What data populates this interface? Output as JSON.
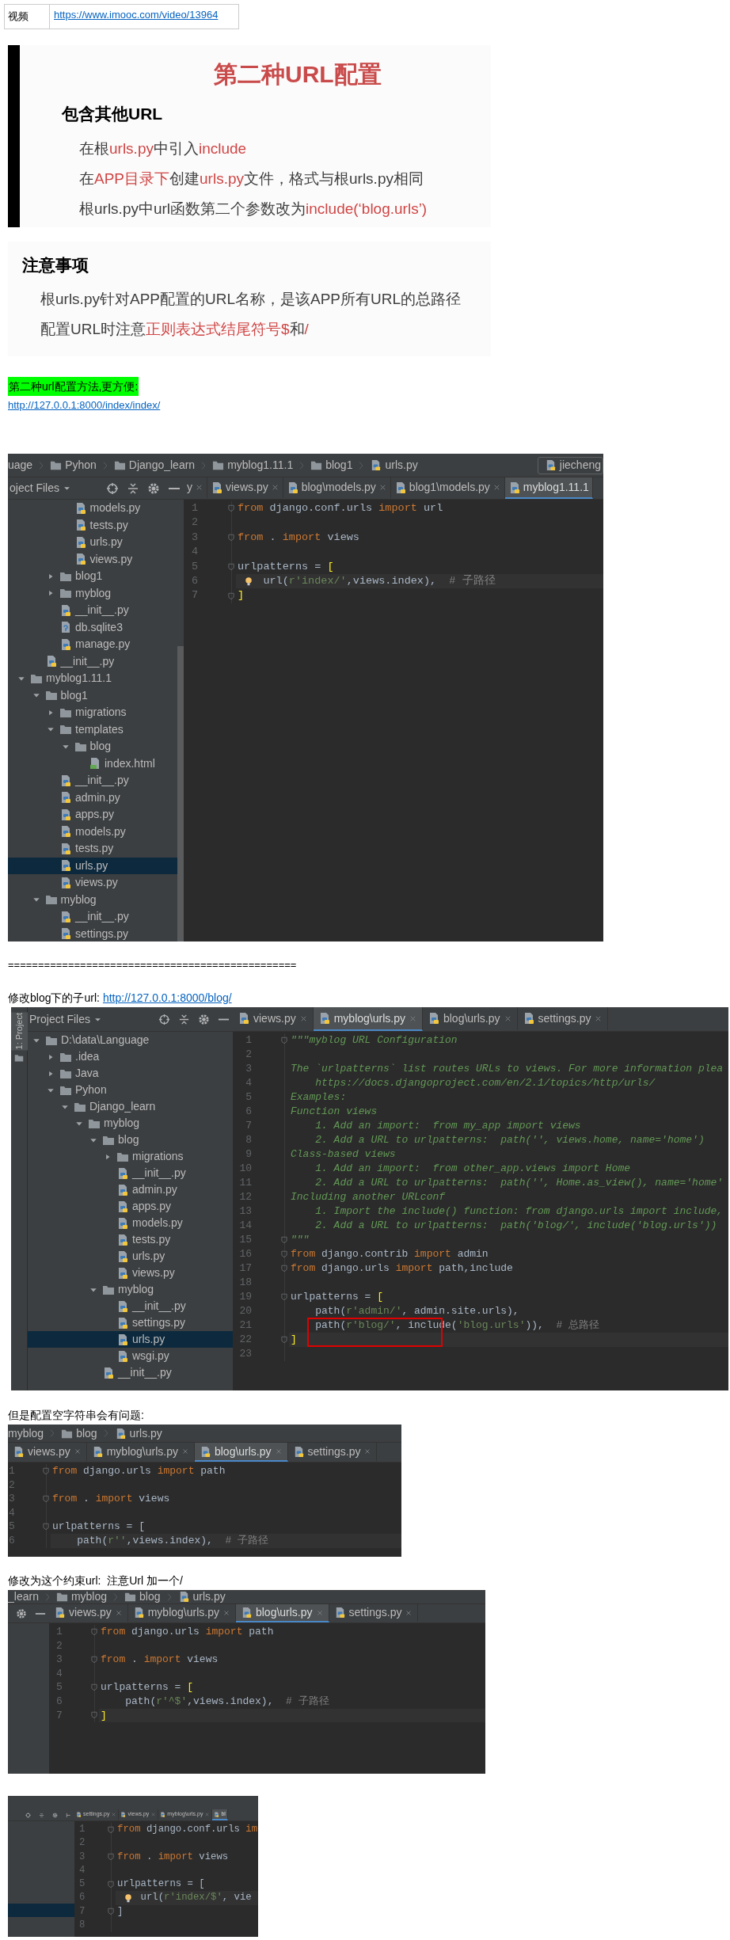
{
  "content": [
    {
      "kind": "table",
      "rows": [
        {
          "label": "视频",
          "link": "https://www.imooc.com/video/13964"
        }
      ]
    },
    {
      "kind": "slide",
      "accent_bar": true,
      "title": "第二种URL配置",
      "heading": "包含其他URL",
      "lines": [
        {
          "segments": [
            {
              "text": "在根",
              "red": false
            },
            {
              "text": "urls.py",
              "red": true
            },
            {
              "text": "中引入",
              "red": false
            },
            {
              "text": "include",
              "red": true
            }
          ]
        },
        {
          "segments": [
            {
              "text": "在",
              "red": false
            },
            {
              "text": "APP目录下",
              "red": true
            },
            {
              "text": "创建",
              "red": false
            },
            {
              "text": "urls.py",
              "red": true
            },
            {
              "text": "文件，格式与根urls.py相同",
              "red": false
            }
          ]
        },
        {
          "segments": [
            {
              "text": "根urls.py中url函数第二个参数改为",
              "red": false
            },
            {
              "text": "include(‘blog.urls’)",
              "red": true
            }
          ]
        }
      ]
    },
    {
      "kind": "slide",
      "accent_bar": false,
      "heading": "注意事项",
      "lines": [
        {
          "segments": [
            {
              "text": "根urls.py针对APP配置的URL名称，是该APP所有URL的总路径",
              "red": false
            }
          ]
        },
        {
          "segments": [
            {
              "text": "配置URL时注意",
              "red": false
            },
            {
              "text": "正则表达式结尾符号$",
              "red": true
            },
            {
              "text": "和",
              "red": false
            },
            {
              "text": "/",
              "red": true
            }
          ]
        }
      ]
    },
    {
      "kind": "note",
      "text": "第二种url配置方法,更方便:",
      "highlighted": true
    },
    {
      "kind": "link",
      "url": "http://127.0.0.1:8000/index/index/"
    },
    {
      "kind": "ide",
      "breadcrumbs": [
        {
          "label": "uage",
          "kind": "partial"
        },
        {
          "label": "Pyhon",
          "kind": "folder"
        },
        {
          "label": "Django_learn",
          "kind": "folder"
        },
        {
          "label": "myblog1.11.1",
          "kind": "folder"
        },
        {
          "label": "blog1",
          "kind": "folder"
        },
        {
          "label": "urls.py",
          "kind": "file"
        }
      ],
      "run_config": "jiecheng",
      "sidebar": {
        "title": "oject Files",
        "tree": [
          {
            "children": [
              {
                "children": [
                  {
                    "children": [
                      {
                        "label": "models.py",
                        "kind": "py",
                        "selected": false
                      },
                      {
                        "label": "tests.py",
                        "kind": "py",
                        "selected": false
                      },
                      {
                        "label": "urls.py",
                        "kind": "py",
                        "selected": false
                      },
                      {
                        "label": "views.py",
                        "kind": "py",
                        "selected": false
                      }
                    ]
                  },
                  {
                    "label": "blog1",
                    "kind": "folder",
                    "expanded": false,
                    "selected": false
                  },
                  {
                    "label": "myblog",
                    "kind": "folder",
                    "expanded": false,
                    "selected": false
                  },
                  {
                    "label": "__init__.py",
                    "kind": "py",
                    "selected": false
                  },
                  {
                    "label": "db.sqlite3",
                    "kind": "db",
                    "selected": false
                  },
                  {
                    "label": "manage.py",
                    "kind": "py",
                    "selected": false
                  }
                ]
              },
              {
                "label": "__init__.py",
                "kind": "py",
                "selected": false
              }
            ]
          },
          {
            "label": "myblog1.11.1",
            "kind": "folder",
            "expanded": true,
            "selected": false,
            "children": [
              {
                "label": "blog1",
                "kind": "folder",
                "expanded": true,
                "selected": false,
                "children": [
                  {
                    "label": "migrations",
                    "kind": "folder",
                    "expanded": false,
                    "selected": false
                  },
                  {
                    "label": "templates",
                    "kind": "folder",
                    "expanded": true,
                    "selected": false,
                    "children": [
                      {
                        "label": "blog",
                        "kind": "folder",
                        "expanded": true,
                        "selected": false,
                        "children": [
                          {
                            "label": "index.html",
                            "kind": "html",
                            "selected": false
                          }
                        ]
                      }
                    ]
                  },
                  {
                    "label": "__init__.py",
                    "kind": "py",
                    "selected": false
                  },
                  {
                    "label": "admin.py",
                    "kind": "py",
                    "selected": false
                  },
                  {
                    "label": "apps.py",
                    "kind": "py",
                    "selected": false
                  },
                  {
                    "label": "models.py",
                    "kind": "py",
                    "selected": false
                  },
                  {
                    "label": "tests.py",
                    "kind": "py",
                    "selected": false
                  },
                  {
                    "label": "urls.py",
                    "kind": "py",
                    "selected": true
                  },
                  {
                    "label": "views.py",
                    "kind": "py",
                    "selected": false
                  }
                ]
              },
              {
                "label": "myblog",
                "kind": "folder",
                "expanded": true,
                "selected": false,
                "children": [
                  {
                    "label": "__init__.py",
                    "kind": "py",
                    "selected": false
                  },
                  {
                    "label": "settings.py",
                    "kind": "py",
                    "selected": false
                  }
                ]
              }
            ]
          }
        ]
      },
      "tabs": [
        {
          "label": "y",
          "icon": false,
          "closable": true,
          "selected": false
        },
        {
          "label": "views.py",
          "icon": true,
          "closable": true,
          "selected": false
        },
        {
          "label": "blog\\models.py",
          "icon": true,
          "closable": true,
          "selected": false
        },
        {
          "label": "blog1\\models.py",
          "icon": true,
          "closable": true,
          "selected": false
        },
        {
          "label": "myblog1.11.1",
          "icon": true,
          "closable": false,
          "selected": true
        }
      ],
      "lines": [
        {
          "number": "1",
          "fold": true,
          "tokens": [
            {
              "kind": "keyword",
              "text": "from"
            },
            {
              "kind": "plain",
              "text": " django.conf.urls "
            },
            {
              "kind": "keyword",
              "text": "import"
            },
            {
              "kind": "plain",
              "text": " url"
            }
          ]
        },
        {
          "number": "2"
        },
        {
          "number": "3",
          "fold": true,
          "tokens": [
            {
              "kind": "keyword",
              "text": "from"
            },
            {
              "kind": "plain",
              "text": " . "
            },
            {
              "kind": "keyword",
              "text": "import"
            },
            {
              "kind": "plain",
              "text": " views"
            }
          ]
        },
        {
          "number": "4"
        },
        {
          "number": "5",
          "fold": true,
          "tokens": [
            {
              "kind": "plain",
              "text": "urlpatterns = "
            },
            {
              "kind": "bracket",
              "text": "["
            }
          ]
        },
        {
          "number": "6",
          "current": true,
          "bulb": true,
          "tokens": [
            {
              "kind": "plain",
              "text": "    url("
            },
            {
              "kind": "string",
              "text": "r'index/'"
            },
            {
              "kind": "plain",
              "text": ",views.index),  "
            },
            {
              "kind": "comment",
              "text": "# 子路径"
            }
          ]
        },
        {
          "number": "7",
          "fold": true,
          "tokens": [
            {
              "kind": "bracket",
              "text": "]"
            }
          ]
        }
      ]
    },
    {
      "kind": "rule",
      "text": "================================================"
    },
    {
      "kind": "paragraph",
      "text": "修改blog下的子url:",
      "link": "http://127.0.0.1:8000/blog/"
    },
    {
      "kind": "ide",
      "tool_strip": {
        "label": "1: Project"
      },
      "sidebar": {
        "title": "Project Files",
        "tree": [
          {
            "label": "D:\\data\\Language",
            "kind": "folder",
            "expanded": true,
            "selected": false,
            "children": [
              {
                "label": ".idea",
                "kind": "folder",
                "expanded": false,
                "selected": false
              },
              {
                "label": "Java",
                "kind": "folder",
                "expanded": false,
                "selected": false
              },
              {
                "label": "Pyhon",
                "kind": "folder",
                "expanded": true,
                "selected": false,
                "children": [
                  {
                    "label": "Django_learn",
                    "kind": "folder",
                    "expanded": true,
                    "selected": false,
                    "children": [
                      {
                        "label": "myblog",
                        "kind": "folder",
                        "expanded": true,
                        "selected": false,
                        "children": [
                          {
                            "label": "blog",
                            "kind": "folder",
                            "expanded": true,
                            "selected": false,
                            "children": [
                              {
                                "label": "migrations",
                                "kind": "folder",
                                "expanded": false,
                                "selected": false
                              },
                              {
                                "label": "__init__.py",
                                "kind": "py",
                                "selected": false
                              },
                              {
                                "label": "admin.py",
                                "kind": "py",
                                "selected": false
                              },
                              {
                                "label": "apps.py",
                                "kind": "py",
                                "selected": false
                              },
                              {
                                "label": "models.py",
                                "kind": "py",
                                "selected": false
                              },
                              {
                                "label": "tests.py",
                                "kind": "py",
                                "selected": false
                              },
                              {
                                "label": "urls.py",
                                "kind": "py",
                                "selected": false
                              },
                              {
                                "label": "views.py",
                                "kind": "py",
                                "selected": false
                              }
                            ]
                          },
                          {
                            "label": "myblog",
                            "kind": "folder",
                            "expanded": true,
                            "selected": false,
                            "children": [
                              {
                                "label": "__init__.py",
                                "kind": "py",
                                "selected": false
                              },
                              {
                                "label": "settings.py",
                                "kind": "py",
                                "selected": false
                              },
                              {
                                "label": "urls.py",
                                "kind": "py",
                                "selected": true
                              },
                              {
                                "label": "wsgi.py",
                                "kind": "py",
                                "selected": false
                              }
                            ]
                          },
                          {
                            "label": "__init__.py",
                            "kind": "py",
                            "selected": false
                          }
                        ]
                      }
                    ]
                  }
                ]
              }
            ]
          }
        ]
      },
      "tabs": [
        {
          "label": "views.py",
          "icon": true,
          "closable": true,
          "selected": false
        },
        {
          "label": "myblog\\urls.py",
          "icon": true,
          "closable": true,
          "selected": true
        },
        {
          "label": "blog\\urls.py",
          "icon": true,
          "closable": true,
          "selected": false
        },
        {
          "label": "settings.py",
          "icon": true,
          "closable": true,
          "selected": false
        }
      ],
      "lines": [
        {
          "number": "1",
          "fold": true,
          "tokens": [
            {
              "kind": "docstring",
              "text": "\"\"\"myblog URL Configuration"
            }
          ]
        },
        {
          "number": "2"
        },
        {
          "number": "3",
          "tokens": [
            {
              "kind": "docstring",
              "text": "The `urlpatterns` list routes URLs to views. For more information plea"
            }
          ]
        },
        {
          "number": "4",
          "tokens": [
            {
              "kind": "docstring",
              "text": "    https://docs.djangoproject.com/en/2.1/topics/http/urls/"
            }
          ]
        },
        {
          "number": "5",
          "tokens": [
            {
              "kind": "docstring",
              "text": "Examples:"
            }
          ]
        },
        {
          "number": "6",
          "tokens": [
            {
              "kind": "docstring",
              "text": "Function views"
            }
          ]
        },
        {
          "number": "7",
          "tokens": [
            {
              "kind": "docstring",
              "text": "    1. Add an import:  from my_app import views"
            }
          ]
        },
        {
          "number": "8",
          "tokens": [
            {
              "kind": "docstring",
              "text": "    2. Add a URL to urlpatterns:  path('', views.home, name='home')"
            }
          ]
        },
        {
          "number": "9",
          "tokens": [
            {
              "kind": "docstring",
              "text": "Class-based views"
            }
          ]
        },
        {
          "number": "10",
          "tokens": [
            {
              "kind": "docstring",
              "text": "    1. Add an import:  from other_app.views import Home"
            }
          ]
        },
        {
          "number": "11",
          "tokens": [
            {
              "kind": "docstring",
              "text": "    2. Add a URL to urlpatterns:  path('', Home.as_view(), name='home'"
            }
          ]
        },
        {
          "number": "12",
          "tokens": [
            {
              "kind": "docstring",
              "text": "Including another URLconf"
            }
          ]
        },
        {
          "number": "13",
          "tokens": [
            {
              "kind": "docstring",
              "text": "    1. Import the include() function: from django.urls import include,"
            }
          ]
        },
        {
          "number": "14",
          "tokens": [
            {
              "kind": "docstring",
              "text": "    2. Add a URL to urlpatterns:  path('blog/', include('blog.urls'))"
            }
          ]
        },
        {
          "number": "15",
          "fold": true,
          "tokens": [
            {
              "kind": "docstring",
              "text": "\"\"\""
            }
          ]
        },
        {
          "number": "16",
          "fold": true,
          "tokens": [
            {
              "kind": "keyword",
              "text": "from"
            },
            {
              "kind": "plain",
              "text": " django.contrib "
            },
            {
              "kind": "keyword",
              "text": "import"
            },
            {
              "kind": "plain",
              "text": " admin"
            }
          ]
        },
        {
          "number": "17",
          "fold": true,
          "tokens": [
            {
              "kind": "keyword",
              "text": "from"
            },
            {
              "kind": "plain",
              "text": " django.urls "
            },
            {
              "kind": "keyword",
              "text": "import"
            },
            {
              "kind": "plain",
              "text": " path,include"
            }
          ]
        },
        {
          "number": "18"
        },
        {
          "number": "19",
          "fold": true,
          "tokens": [
            {
              "kind": "plain",
              "text": "urlpatterns = "
            },
            {
              "kind": "bracket",
              "text": "["
            }
          ]
        },
        {
          "number": "20",
          "tokens": [
            {
              "kind": "plain",
              "text": "    path("
            },
            {
              "kind": "string",
              "text": "r'admin/'"
            },
            {
              "kind": "plain",
              "text": ", admin.site.urls),"
            }
          ]
        },
        {
          "number": "21",
          "boxed": true,
          "tokens": [
            {
              "kind": "plain",
              "text": "    path("
            },
            {
              "kind": "string",
              "text": "r'blog/'"
            },
            {
              "kind": "plain",
              "text": ", include("
            },
            {
              "kind": "string",
              "text": "'blog.urls'"
            },
            {
              "kind": "plain",
              "text": ")),  "
            },
            {
              "kind": "comment",
              "text": "# 总路径"
            }
          ]
        },
        {
          "number": "22",
          "current": true,
          "fold": true,
          "tokens": [
            {
              "kind": "bracket",
              "text": "]"
            }
          ]
        },
        {
          "number": "23"
        }
      ]
    },
    {
      "kind": "paragraph",
      "text": "但是配置空字符串会有问题:"
    },
    {
      "kind": "ide",
      "breadcrumbs": [
        {
          "label": "myblog",
          "kind": "partial"
        },
        {
          "label": "blog",
          "kind": "folder"
        },
        {
          "label": "urls.py",
          "kind": "file"
        }
      ],
      "tabs": [
        {
          "label": "views.py",
          "icon": true,
          "closable": true,
          "selected": false
        },
        {
          "label": "myblog\\urls.py",
          "icon": true,
          "closable": true,
          "selected": false
        },
        {
          "label": "blog\\urls.py",
          "icon": true,
          "closable": true,
          "selected": true
        },
        {
          "label": "settings.py",
          "icon": true,
          "closable": true,
          "selected": false
        }
      ],
      "lines": [
        {
          "number": "1",
          "fold": true,
          "tokens": [
            {
              "kind": "keyword",
              "text": "from"
            },
            {
              "kind": "plain",
              "text": " django.urls "
            },
            {
              "kind": "keyword",
              "text": "import"
            },
            {
              "kind": "plain",
              "text": " path"
            }
          ]
        },
        {
          "number": "2"
        },
        {
          "number": "3",
          "fold": true,
          "tokens": [
            {
              "kind": "keyword",
              "text": "from"
            },
            {
              "kind": "plain",
              "text": " . "
            },
            {
              "kind": "keyword",
              "text": "import"
            },
            {
              "kind": "plain",
              "text": " views"
            }
          ]
        },
        {
          "number": "4"
        },
        {
          "number": "5",
          "fold": true,
          "tokens": [
            {
              "kind": "plain",
              "text": "urlpatterns = ["
            }
          ]
        },
        {
          "number": "6",
          "current": true,
          "tokens": [
            {
              "kind": "plain",
              "text": "    path("
            },
            {
              "kind": "string",
              "text": "r''"
            },
            {
              "kind": "plain",
              "text": ",views.index),  "
            },
            {
              "kind": "comment",
              "text": "# 子路径"
            }
          ]
        }
      ]
    },
    {
      "kind": "paragraph",
      "text": "修改为这个约束url:  注意Url 加一个/"
    },
    {
      "kind": "ide",
      "breadcrumbs": [
        {
          "label": "_learn",
          "kind": "partial"
        },
        {
          "label": "myblog",
          "kind": "folder"
        },
        {
          "label": "blog",
          "kind": "folder"
        },
        {
          "label": "urls.py",
          "kind": "file"
        }
      ],
      "tabs": [
        {
          "label": "views.py",
          "icon": true,
          "closable": true,
          "selected": false
        },
        {
          "label": "myblog\\urls.py",
          "icon": true,
          "closable": true,
          "selected": false
        },
        {
          "label": "blog\\urls.py",
          "icon": true,
          "closable": true,
          "selected": true
        },
        {
          "label": "settings.py",
          "icon": true,
          "closable": true,
          "selected": false
        }
      ],
      "lines": [
        {
          "number": "1",
          "fold": true,
          "tokens": [
            {
              "kind": "keyword",
              "text": "from"
            },
            {
              "kind": "plain",
              "text": " django.urls "
            },
            {
              "kind": "keyword",
              "text": "import"
            },
            {
              "kind": "plain",
              "text": " path"
            }
          ]
        },
        {
          "number": "2"
        },
        {
          "number": "3",
          "fold": true,
          "tokens": [
            {
              "kind": "keyword",
              "text": "from"
            },
            {
              "kind": "plain",
              "text": " . "
            },
            {
              "kind": "keyword",
              "text": "import"
            },
            {
              "kind": "plain",
              "text": " views"
            }
          ]
        },
        {
          "number": "4"
        },
        {
          "number": "5",
          "fold": true,
          "tokens": [
            {
              "kind": "plain",
              "text": "urlpatterns = "
            },
            {
              "kind": "bracket",
              "text": "["
            }
          ]
        },
        {
          "number": "6",
          "tokens": [
            {
              "kind": "plain",
              "text": "    path("
            },
            {
              "kind": "string",
              "text": "r'^$'"
            },
            {
              "kind": "plain",
              "text": ",views.index),  "
            },
            {
              "kind": "comment",
              "text": "# 子路径"
            }
          ]
        },
        {
          "number": "7",
          "current": true,
          "fold": true,
          "tokens": [
            {
              "kind": "bracket",
              "text": "]"
            }
          ]
        }
      ]
    },
    {
      "kind": "ide",
      "sidebar": {
        "tree": [
          {
            "kind": "blank",
            "selected": true
          }
        ]
      },
      "tabs": [
        {
          "label": "settings.py",
          "icon": true,
          "closable": true,
          "selected": false
        },
        {
          "label": "views.py",
          "icon": true,
          "closable": true,
          "selected": false
        },
        {
          "label": "myblog\\urls.py",
          "icon": true,
          "closable": true,
          "selected": false
        },
        {
          "label": "bl",
          "icon": true,
          "closable": false,
          "selected": true
        }
      ],
      "lines": [
        {
          "number": "1",
          "fold": true,
          "tokens": [
            {
              "kind": "keyword",
              "text": "from"
            },
            {
              "kind": "plain",
              "text": " django.conf.urls "
            },
            {
              "kind": "keyword",
              "text": "im"
            }
          ]
        },
        {
          "number": "2"
        },
        {
          "number": "3",
          "fold": true,
          "tokens": [
            {
              "kind": "keyword",
              "text": "from"
            },
            {
              "kind": "plain",
              "text": " . "
            },
            {
              "kind": "keyword",
              "text": "import"
            },
            {
              "kind": "plain",
              "text": " views"
            }
          ]
        },
        {
          "number": "4"
        },
        {
          "number": "5",
          "fold": true,
          "tokens": [
            {
              "kind": "plain",
              "text": "urlpatterns = ["
            }
          ]
        },
        {
          "number": "6",
          "current": true,
          "bulb": true,
          "tokens": [
            {
              "kind": "plain",
              "text": "    url("
            },
            {
              "kind": "string",
              "text": "r'index/$'"
            },
            {
              "kind": "plain",
              "text": ", vie"
            }
          ]
        },
        {
          "number": "7",
          "fold": true,
          "tokens": [
            {
              "kind": "plain",
              "text": "]"
            }
          ]
        },
        {
          "number": "8"
        }
      ]
    }
  ]
}
